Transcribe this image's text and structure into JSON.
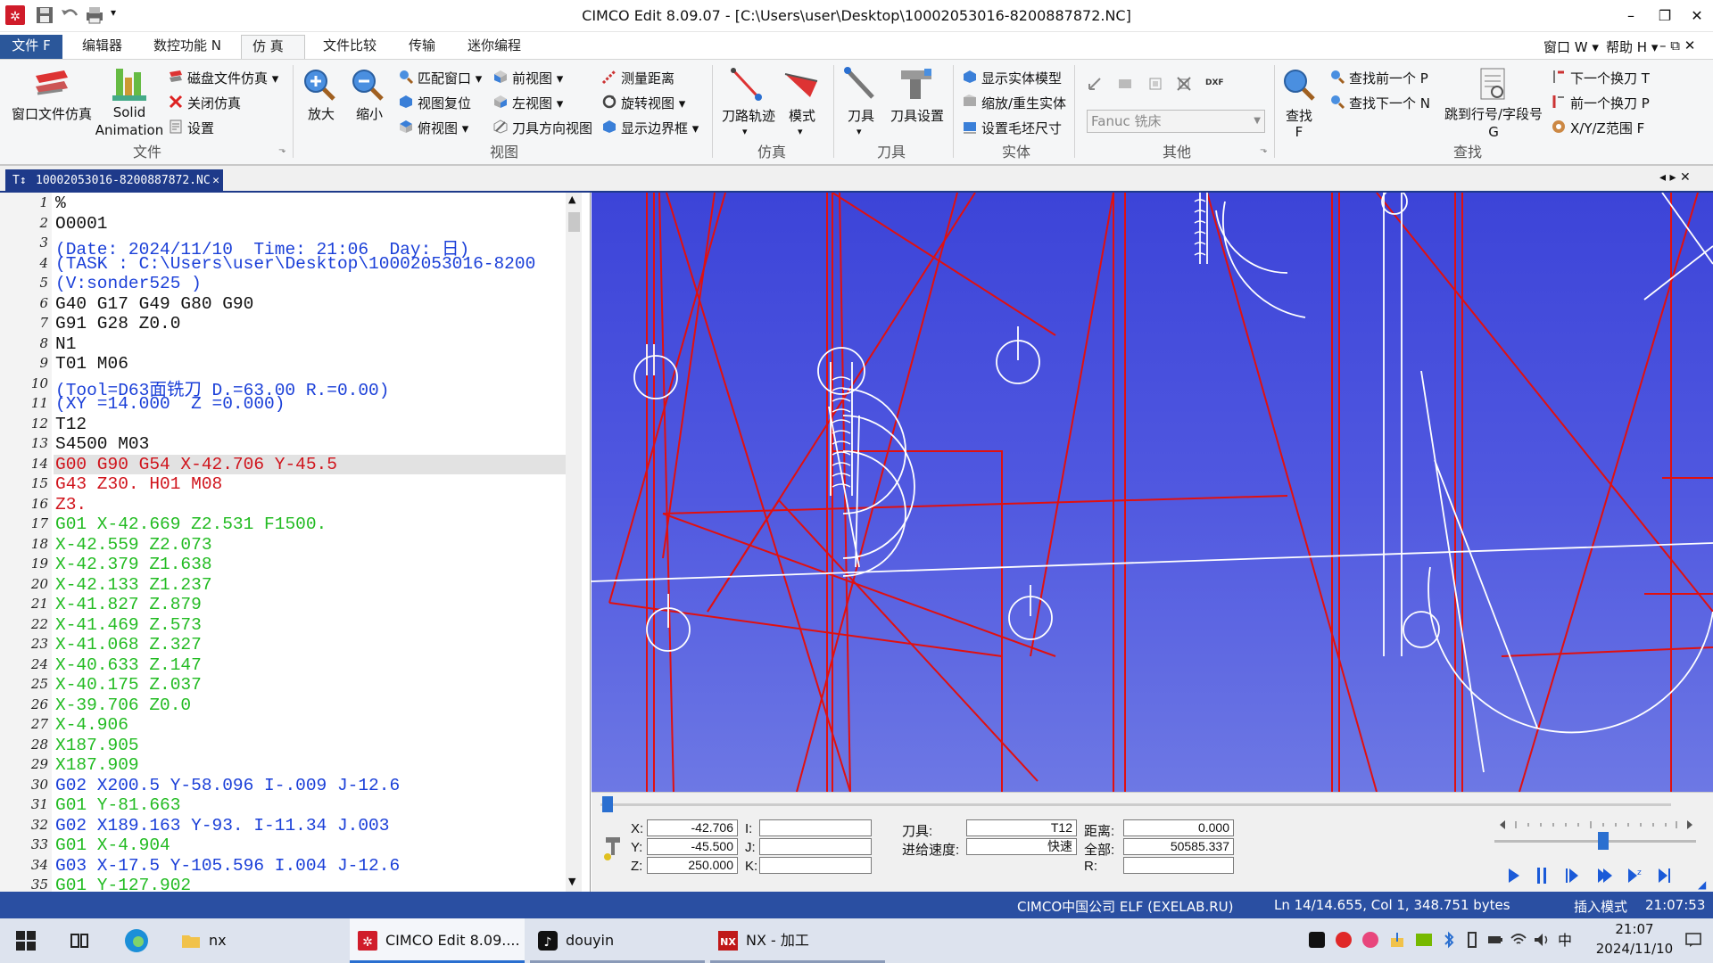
{
  "window": {
    "title": "CIMCO Edit 8.09.07 - [C:\\Users\\user\\Desktop\\10002053016-8200887872.NC]",
    "controls": [
      "–",
      "❐",
      "✕"
    ]
  },
  "menu": {
    "tabs": [
      "文件 F",
      "编辑器",
      "数控功能 N",
      "仿 真",
      "文件比较",
      "传输",
      "迷你编程"
    ],
    "right": [
      "窗口 W ▾",
      "帮助 H ▾",
      "– ⧉ ✕"
    ]
  },
  "ribbon": {
    "groups": {
      "file": "文件",
      "view": "视图",
      "sim": "仿真",
      "tool": "刀具",
      "solid": "实体",
      "other": "其他",
      "find": "查找"
    },
    "file": {
      "window_sim": "窗口文件仿真",
      "solid_anim_1": "Solid",
      "solid_anim_2": "Animation",
      "disk_sim": "磁盘文件仿真 ▾",
      "close_sim": "关闭仿真",
      "settings": "设置"
    },
    "view": {
      "zoom_in": "放大",
      "zoom_out": "缩小",
      "fit_window": "匹配窗口 ▾",
      "reset_view": "视图复位",
      "top_view": "俯视图 ▾",
      "front_view": "前视图 ▾",
      "left_view": "左视图 ▾",
      "tool_dir_view": "刀具方向视图",
      "measure": "测量距离",
      "rotate_view": "旋转视图 ▾",
      "show_bounds": "显示边界框 ▾"
    },
    "sim": {
      "toolpath": "刀路轨迹",
      "mode": "模式"
    },
    "tool": {
      "tool": "刀具",
      "tool_setup": "刀具设置"
    },
    "solid": {
      "show_model": "显示实体模型",
      "resize": "缩放/重生实体",
      "stock_size": "设置毛坯尺寸"
    },
    "other": {
      "machine": "Fanuc 铣床"
    },
    "find": {
      "find": "查找",
      "find_key": "F",
      "find_prev": "查找前一个 P",
      "find_next": "查找下一个 N",
      "goto_line": "跳到行号/字段号",
      "goto_key": "G",
      "next_tool": "下一个换刀 T",
      "prev_tool": "前一个换刀 P",
      "xyz_range": "X/Y/Z范围 F"
    }
  },
  "doc_tab": {
    "name": "10002053016-8200887872.NC",
    "nav": "◂ ▸ ✕"
  },
  "editor": {
    "lines": [
      {
        "n": "1",
        "text": "%",
        "color": "#111111"
      },
      {
        "n": "2",
        "text": "O0001",
        "color": "#111111"
      },
      {
        "n": "3",
        "text": "(Date: 2024/11/10  Time: 21:06  Day: 日)",
        "color": "#1a3fd8"
      },
      {
        "n": "4",
        "text": "(TASK : C:\\Users\\user\\Desktop\\10002053016-8200",
        "color": "#1a3fd8"
      },
      {
        "n": "5",
        "text": "(V:sonder525 )",
        "color": "#1a3fd8"
      },
      {
        "n": "6",
        "text": "G40 G17 G49 G80 G90",
        "color": "#111111"
      },
      {
        "n": "7",
        "text": "G91 G28 Z0.0",
        "color": "#111111"
      },
      {
        "n": "8",
        "text": "N1",
        "color": "#111111"
      },
      {
        "n": "9",
        "text": "T01 M06",
        "color": "#111111"
      },
      {
        "n": "10",
        "text": "(Tool=D63面铣刀 D.=63.00 R.=0.00)",
        "color": "#1a3fd8"
      },
      {
        "n": "11",
        "text": "(XY =14.000  Z =0.000)",
        "color": "#1a3fd8"
      },
      {
        "n": "12",
        "text": "T12",
        "color": "#111111"
      },
      {
        "n": "13",
        "text": "S4500 M03",
        "color": "#111111"
      },
      {
        "n": "14",
        "text": "G00 G90 G54 X-42.706 Y-45.5",
        "color": "#d0141c"
      },
      {
        "n": "15",
        "text": "G43 Z30. H01 M08",
        "color": "#d0141c"
      },
      {
        "n": "16",
        "text": "Z3.",
        "color": "#d0141c"
      },
      {
        "n": "17",
        "text": "G01 X-42.669 Z2.531 F1500.",
        "color": "#22bb22"
      },
      {
        "n": "18",
        "text": "X-42.559 Z2.073",
        "color": "#22bb22"
      },
      {
        "n": "19",
        "text": "X-42.379 Z1.638",
        "color": "#22bb22"
      },
      {
        "n": "20",
        "text": "X-42.133 Z1.237",
        "color": "#22bb22"
      },
      {
        "n": "21",
        "text": "X-41.827 Z.879",
        "color": "#22bb22"
      },
      {
        "n": "22",
        "text": "X-41.469 Z.573",
        "color": "#22bb22"
      },
      {
        "n": "23",
        "text": "X-41.068 Z.327",
        "color": "#22bb22"
      },
      {
        "n": "24",
        "text": "X-40.633 Z.147",
        "color": "#22bb22"
      },
      {
        "n": "25",
        "text": "X-40.175 Z.037",
        "color": "#22bb22"
      },
      {
        "n": "26",
        "text": "X-39.706 Z0.0",
        "color": "#22bb22"
      },
      {
        "n": "27",
        "text": "X-4.906",
        "color": "#22bb22"
      },
      {
        "n": "28",
        "text": "X187.905",
        "color": "#22bb22"
      },
      {
        "n": "29",
        "text": "X187.909",
        "color": "#22bb22"
      },
      {
        "n": "30",
        "text": "G02 X200.5 Y-58.096 I-.009 J-12.6",
        "color": "#1a3fd8"
      },
      {
        "n": "31",
        "text": "G01 Y-81.663",
        "color": "#22bb22"
      },
      {
        "n": "32",
        "text": "G02 X189.163 Y-93. I-11.34 J.003",
        "color": "#1a3fd8"
      },
      {
        "n": "33",
        "text": "G01 X-4.904",
        "color": "#22bb22"
      },
      {
        "n": "34",
        "text": "G03 X-17.5 Y-105.596 I.004 J-12.6",
        "color": "#1a3fd8"
      },
      {
        "n": "35",
        "text": "G01 Y-127.902",
        "color": "#22bb22"
      }
    ]
  },
  "panel": {
    "x_label": "X:",
    "x_val": "-42.706",
    "y_label": "Y:",
    "y_val": "-45.500",
    "z_label": "Z:",
    "z_val": "250.000",
    "i_label": "I:",
    "j_label": "J:",
    "k_label": "K:",
    "tool_label": "刀具:",
    "tool_val": "T12",
    "feed_label": "进给速度:",
    "feed_val": "快速",
    "dist_label": "距离:",
    "dist_val": "0.000",
    "total_label": "全部:",
    "total_val": "50585.337",
    "r_label": "R:"
  },
  "status": {
    "company": "CIMCO中国公司 ELF (EXELAB.RU)",
    "position": "Ln 14/14.655, Col 1, 348.751 bytes",
    "mode": "插入模式",
    "time": "21:07:53"
  },
  "taskbar": {
    "items": [
      "nx",
      "CIMCO Edit 8.09....",
      "douyin",
      "NX - 加工"
    ],
    "ime": "中",
    "clock_time": "21:07",
    "clock_date": "2024/11/10"
  },
  "colors": {
    "status_bar": "#2a4fa2",
    "file_tab": "#2b579a",
    "toolpath_rapid": "#e01010",
    "toolpath_tool": "#ffffff",
    "viewport_top": "#3c44d8",
    "viewport_bottom": "#6d78e4"
  }
}
